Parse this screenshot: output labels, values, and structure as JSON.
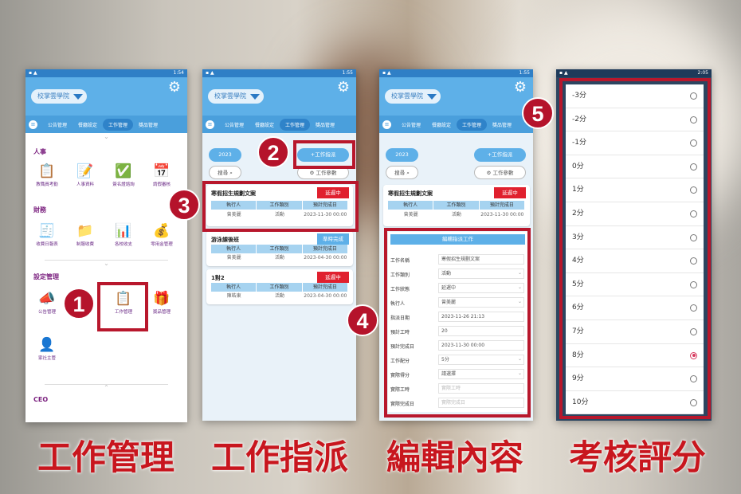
{
  "colors": {
    "accent_red": "#c8161e",
    "header_blue": "#5eb0e8",
    "badge_red": "#b5132b",
    "status_delay": "#e0202e",
    "status_done": "#5eb0e8"
  },
  "app": {
    "school": "校掌雲學院",
    "settings_icon": "gear-icon",
    "menu_icon": "hamburger-icon",
    "tabs": [
      "公告管理",
      "餐廳設定",
      "工作管理",
      "獎品管理"
    ],
    "active_tab": "工作管理"
  },
  "phone1": {
    "time": "1:54",
    "sections": [
      {
        "title": "人事",
        "items": [
          {
            "label": "教職員考勤",
            "icon": "attendance-icon",
            "color": "#f0b030"
          },
          {
            "label": "人事資料",
            "icon": "personnel-icon",
            "color": "#4a8ad8"
          },
          {
            "label": "簽名證諮詢",
            "icon": "certificate-check-icon",
            "color": "#2aa870"
          },
          {
            "label": "請假審核",
            "icon": "leave-review-icon",
            "color": "#e05040"
          }
        ]
      },
      {
        "title": "財務",
        "items": [
          {
            "label": "收費日報表",
            "icon": "receipt-icon",
            "color": "#2aa870"
          },
          {
            "label": "制服收費",
            "icon": "folder-icon",
            "color": "#f0b030"
          },
          {
            "label": "各校收支",
            "icon": "report-icon",
            "color": "#e05040"
          },
          {
            "label": "零用金管理",
            "icon": "money-bag-icon",
            "color": "#4a8ad8"
          }
        ]
      },
      {
        "title": "設定管理",
        "items": [
          {
            "label": "公告管理",
            "icon": "megaphone-icon",
            "color": "#2aa870"
          },
          {
            "label": "",
            "icon": "settings-icon",
            "color": "#999"
          },
          {
            "label": "工作管理",
            "icon": "task-settings-icon",
            "color": "#e05040"
          },
          {
            "label": "獎品管理",
            "icon": "gift-icon",
            "color": "#4a8ad8"
          },
          {
            "label": "家社主管",
            "icon": "supervisor-icon",
            "color": "#e05040"
          }
        ]
      },
      {
        "title": "CEO",
        "items": []
      }
    ]
  },
  "tasks": {
    "year": "2023",
    "assign_button": "+工作指派",
    "search_button": "搜尋",
    "params_button": "工作參數",
    "columns": [
      "執行人",
      "工作類別",
      "預計完成日"
    ],
    "cards": [
      {
        "title": "寒假招生規劃文案",
        "status": "延遲中",
        "status_type": "delay",
        "executor": "曾美麗",
        "category": "活動",
        "due": "2023-11-30 00:00"
      },
      {
        "title": "游泳課後班",
        "status": "準時完成",
        "status_type": "done",
        "executor": "曾美麗",
        "category": "活動",
        "due": "2023-04-30 00:00"
      },
      {
        "title": "1對2",
        "status": "延遲中",
        "status_type": "delay",
        "executor": "陳皓東",
        "category": "活動",
        "due": "2023-04-30 00:00"
      }
    ]
  },
  "phone2": {
    "time": "1:55"
  },
  "phone3": {
    "time": "1:55"
  },
  "edit_form": {
    "title": "編輯指派工作",
    "fields": [
      {
        "label": "工作名稱",
        "value": "寒假招生規劃文案",
        "type": "text"
      },
      {
        "label": "工作類別",
        "value": "活動",
        "type": "select"
      },
      {
        "label": "工作狀態",
        "value": "延遲中",
        "type": "select"
      },
      {
        "label": "執行人",
        "value": "曾美麗",
        "type": "select"
      },
      {
        "label": "指派日期",
        "value": "2023-11-26 21:13",
        "type": "text"
      },
      {
        "label": "預計工時",
        "value": "20",
        "type": "text"
      },
      {
        "label": "預計完成日",
        "value": "2023-11-30 00:00",
        "type": "text"
      },
      {
        "label": "工作配分",
        "value": "5分",
        "type": "select"
      },
      {
        "label": "實際得分",
        "value": "請選擇",
        "type": "select"
      },
      {
        "label": "實際工時",
        "placeholder": "實際工時",
        "type": "text"
      },
      {
        "label": "實際完成日",
        "placeholder": "實際完成日",
        "type": "text"
      }
    ]
  },
  "phone4": {
    "time": "2:05",
    "options": [
      "-3分",
      "-2分",
      "-1分",
      "0分",
      "1分",
      "2分",
      "3分",
      "4分",
      "5分",
      "6分",
      "7分",
      "8分",
      "9分",
      "10分"
    ],
    "selected": "8分"
  },
  "steps": [
    "1",
    "2",
    "3",
    "4",
    "5"
  ],
  "captions": [
    "工作管理",
    "工作指派",
    "編輯內容",
    "考核評分"
  ]
}
